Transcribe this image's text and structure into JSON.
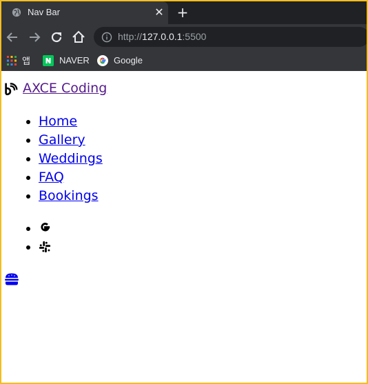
{
  "browser": {
    "tab": {
      "title": "Nav Bar",
      "favicon": "globe-icon",
      "close_icon": "close-icon"
    },
    "new_tab_icon": "plus-icon",
    "toolbar": {
      "back_icon": "back-arrow-icon",
      "forward_icon": "forward-arrow-icon",
      "reload_icon": "reload-icon",
      "home_icon": "home-icon",
      "info_icon": "info-icon"
    },
    "url": {
      "scheme": "http://",
      "host": "127.0.0.1",
      "port": ":5500"
    },
    "bookmarks": [
      {
        "label": "앱",
        "icon": "apps-grid-icon"
      },
      {
        "label": "NAVER",
        "icon": "naver-icon",
        "color": "#03c75a"
      },
      {
        "label": "Google",
        "icon": "google-icon"
      }
    ]
  },
  "page": {
    "brand": {
      "icon": "blogger-b-icon",
      "text": "AXCE Coding"
    },
    "nav_links": [
      "Home",
      "Gallery",
      "Weddings",
      "FAQ",
      "Bookings"
    ],
    "social_icons": [
      "google-icon",
      "slack-icon"
    ],
    "menu_toggle_icon": "hamburger-icon",
    "colors": {
      "link": "#0000ee",
      "visited_link": "#551a8b",
      "hamburger": "#0000ee"
    }
  }
}
